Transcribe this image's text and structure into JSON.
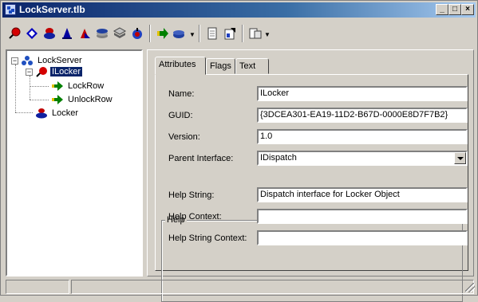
{
  "window": {
    "title": "LockServer.tlb",
    "minimize_label": "_",
    "maximize_label": "□",
    "close_label": "×"
  },
  "toolbar": {
    "buttons": [
      {
        "icon": "interface-icon"
      },
      {
        "icon": "dispinterface-icon"
      },
      {
        "icon": "coclass-icon"
      },
      {
        "icon": "module-icon"
      },
      {
        "icon": "enum-icon"
      },
      {
        "icon": "struct-icon"
      },
      {
        "icon": "union-icon"
      },
      {
        "icon": "alias-icon"
      },
      {
        "icon": "method-icon"
      },
      {
        "icon": "property-icon"
      },
      {
        "icon": "refresh-icon"
      },
      {
        "icon": "register-icon"
      },
      {
        "icon": "view-icon"
      }
    ]
  },
  "tree": {
    "root": "LockServer",
    "interface": "ILocker",
    "methods": [
      "LockRow",
      "UnlockRow"
    ],
    "coclass": "Locker"
  },
  "tabs": [
    "Attributes",
    "Flags",
    "Text"
  ],
  "attributes": {
    "name_label": "Name:",
    "name_value": "ILocker",
    "guid_label": "GUID:",
    "guid_value": "{3DCEA301-EA19-11D2-B67D-0000E8D7F7B2}",
    "version_label": "Version:",
    "version_value": "1.0",
    "parent_label": "Parent Interface:",
    "parent_value": "IDispatch",
    "help_group_label": "Help",
    "help_string_label": "Help String:",
    "help_string_value": "Dispatch interface for Locker Object",
    "help_context_label": "Help Context:",
    "help_context_value": "",
    "help_string_context_label": "Help String Context:",
    "help_string_context_value": ""
  },
  "colors": {
    "titlebar_start": "#0a246a",
    "titlebar_end": "#a6caf0",
    "selection": "#0a246a",
    "face": "#d4d0c8"
  }
}
